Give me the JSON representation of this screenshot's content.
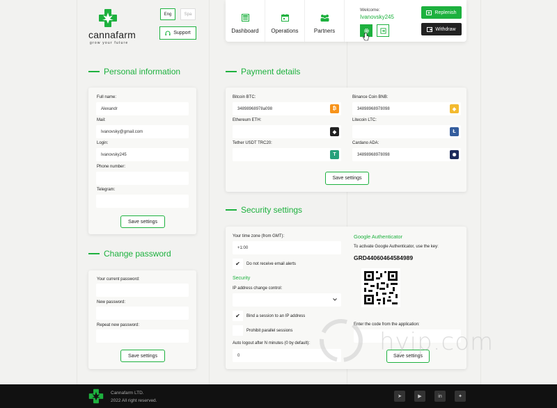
{
  "brand": {
    "name": "cannafarm",
    "tagline": "grow your future"
  },
  "lang": {
    "active": "Eng",
    "inactive": "Spa"
  },
  "support_label": "Support",
  "nav": [
    {
      "label": "Dashboard",
      "icon": "dashboard-icon"
    },
    {
      "label": "Operations",
      "icon": "calendar-icon"
    },
    {
      "label": "Partners",
      "icon": "partners-icon"
    }
  ],
  "welcome": {
    "label": "Welcome:",
    "user": "Ivanovsky245"
  },
  "actions": {
    "replenish": "Replenish",
    "withdraw": "Withdraw"
  },
  "personal": {
    "title": "Personal information",
    "full_name_label": "Full name:",
    "full_name": "Alexandr",
    "mail_label": "Mail:",
    "mail": "Ivanovsky@gmail.com",
    "login_label": "Login:",
    "login": "Ivanovsky245",
    "phone_label": "Phone number:",
    "phone": "",
    "telegram_label": "Telegram:",
    "telegram": "",
    "save": "Save settings"
  },
  "password": {
    "title": "Change password",
    "current_label": "Your current password:",
    "new_label": "New password:",
    "repeat_label": "Repeat new password:",
    "save": "Save settings"
  },
  "payment": {
    "title": "Payment details",
    "btc_label": "Bitcoin BTC:",
    "btc": "34898968978a098",
    "eth_label": "Ethereum ETH:",
    "eth": "",
    "usdt_label": "Tether USDT TRC20:",
    "usdt": "",
    "bnb_label": "Binance Coin BNB:",
    "bnb": "34898968978098",
    "ltc_label": "Litecoin LTC:",
    "ltc": "",
    "ada_label": "Cardano ADA:",
    "ada": "34898968978098",
    "save": "Save settings",
    "colors": {
      "btc": "#f7931a",
      "eth": "#222222",
      "usdt": "#26a17b",
      "bnb": "#f3ba2f",
      "ltc": "#345d9d",
      "ada": "#1b2a5b"
    }
  },
  "security": {
    "title": "Security settings",
    "tz_label": "Your time zone (from GMT):",
    "tz": "+1:00",
    "no_email_label": "Do not receive email alerts",
    "sub_title": "Security",
    "ip_label": "IP address change control:",
    "bind_label": "Bind a session to an IP address",
    "parallel_label": "Prohibit parallel sessions",
    "autologout_label": "Auto logout after N minutes (0 by default):",
    "autologout": "0",
    "ga_title": "Google Authenticator",
    "ga_hint": "To activate Google Authenticator, use the key:",
    "ga_key": "GRD44060464584989",
    "code_label": "Enter the code from the application:",
    "save": "Save settings"
  },
  "footer": {
    "company": "Cannafarm LTD.",
    "rights": "2022 All right reserved."
  },
  "watermark": "hyip.com",
  "accent": "#1db13e"
}
